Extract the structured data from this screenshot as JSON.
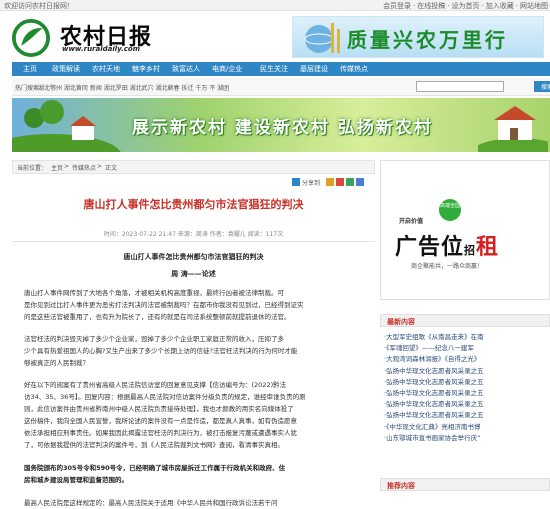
{
  "topbar": {
    "welcome": "欢迎访问农村日报网！",
    "links": [
      "会员登录",
      "·",
      "在线投稿",
      "·",
      "设为首页",
      "·",
      "加入收藏",
      "·",
      "网站地图"
    ]
  },
  "header": {
    "logo_title": "农村日报",
    "logo_url": "www.ruraldaily.com",
    "banner_slogan": "质量兴农万里行"
  },
  "nav": {
    "items": [
      "主页",
      "政策解读",
      "农村天地",
      "魅李乡村",
      "致富达人",
      "电商/企业",
      "民生关注",
      "基层建设",
      "传媒热点"
    ]
  },
  "hotbar": {
    "label": "热门搜索：",
    "words": "湖北鄂州 湖北黄冈 新闻 湖北罗田 湖北武穴 湖北蕲春 拆迁 千万 不 湖团",
    "search_placeholder": "",
    "search_button": "搜索"
  },
  "banner_mid": {
    "slogan": "展示新农村 建设新农村 弘扬新农村"
  },
  "breadcrumb": {
    "prefix": "当前位置：",
    "items": [
      "主页",
      ">",
      "传媒热点",
      ">",
      "正文"
    ]
  },
  "share": {
    "label": "分享到"
  },
  "article": {
    "title": "唐山打人事件怎比贵州都匀市法官猖狂的判决",
    "meta": "时间：2023-07-22 21:47 来源：周涛 作者：袁耀儿 阅读：117次",
    "sub_title": "唐山打人事件怎比贵州都匀市法官猖狂的判决",
    "author": "周 涛——论述",
    "paragraphs": [
      {
        "bold": false,
        "lines": [
          "    唐山打人事件网传到了大地各个角落，才被相关机构高度重视，最终行凶者被法律制裁。可",
          "是你见到过比打人事件更为恶劣打法判决的法官被制裁吗？在都市你我没有见到过，已经得到证实",
          "的是这些法官被重用了，也有升为院长了，还有的就是在司法系统整顿前就提前退休的法官。"
        ]
      },
      {
        "bold": false,
        "lines": [
          "    法官枉法的判决毁灭掉了多少个企业家，毁掉了多少个企业职工家庭正常的收入，压抑了多",
          "少个具有热爱祖国人的心胸?又生产出来了多少个长期上访的信徒?法官枉法判决的行为何时才能",
          "够被真正的人民制裁？"
        ]
      },
      {
        "bold": false,
        "lines": [
          "    好在以下的阅案有了贵州省高级人民法院信访室的回复意见支撑【信访编号为：(2022)黔法",
          "访34、35、36号】。回复内容：根据最高人民法院对信访案件分级负责的规定，谁经审谁负责的原",
          "则，此信访案件由贵州省黔南州中级人民法院负责接待处理】，我也才颜教的用实名向媒体投了",
          "这份稿件，我向全国人民宣誓，我所论述的案件没有一点是作造，都是真人真事，如有伪造愿意",
          "依法承担相应刑事责任。如果我因此揭露法官枉法的判决行为，被打击报复污蔑或遭遇事实人犹",
          "了，可依据我提供的法官判决的案件号，到《人民法院裁判文书网》查阅，看清事实真相。"
        ]
      },
      {
        "bold": true,
        "lines": [
          "    国务院颁布的305号令和590号令，已经明确了城市房屋拆迁工作属于行政机关和政府、住",
          "房和城乡建设局管理和监督范围的。"
        ]
      },
      {
        "bold": false,
        "lines": [
          "    最高人民法院是这样规定的：最高人民法院关于适用《中华人民共和国行政诉讼法若干问"
        ]
      }
    ]
  },
  "sidebar": {
    "ad": {
      "top": "开启价值",
      "badge": "高端全国",
      "main_black": "广告位",
      "main_small": "招",
      "main_red": "租",
      "sub": "商企聚能共，一路众商赢！"
    },
    "latest_title": "最新内容",
    "latest_items": [
      "·大型军史组歌《从南昌走来》在南",
      "·《军魂回望》——纪念八一建军",
      "·大观湾词森林润报》《自得之光》",
      "·弘扬中华现文化志愿者风采录之五",
      "·弘扬中华现文化志愿者风采录之五",
      "·弘扬中华现文化志愿者风采录之五",
      "·弘扬中华现文化志愿者风采录之五",
      "·弘扬中华现文化志愿者风采录之五",
      "·《中华现文化汇典》亮相济南书博",
      "·山东鄂城市直书画家协会举行庆“"
    ],
    "recommend_title": "推荐内容"
  }
}
